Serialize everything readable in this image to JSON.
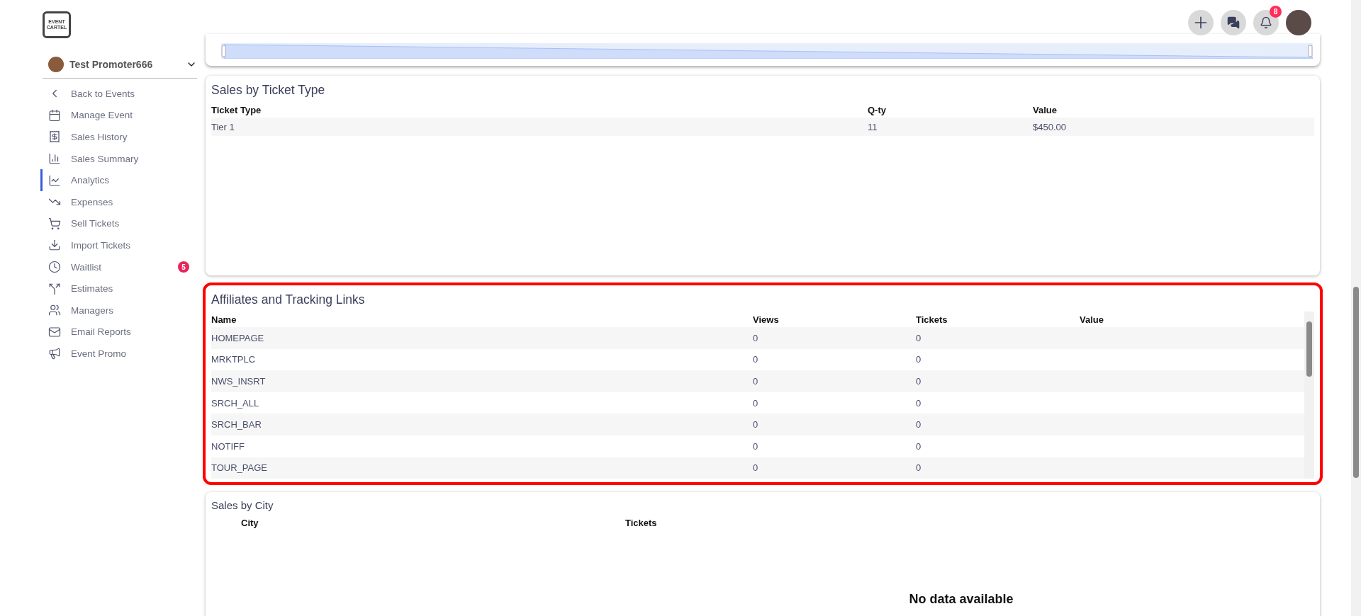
{
  "logo": {
    "line_1": "EVENT",
    "line_2": "CARTEL"
  },
  "header": {
    "notifications_badge": "8"
  },
  "sidebar": {
    "profile_name": "Test Promoter666",
    "items": [
      {
        "label": "Back to Events",
        "selected": false
      },
      {
        "label": "Manage Event",
        "selected": false
      },
      {
        "label": "Sales History",
        "selected": false
      },
      {
        "label": "Sales Summary",
        "selected": false
      },
      {
        "label": "Analytics",
        "selected": true
      },
      {
        "label": "Expenses",
        "selected": false
      },
      {
        "label": "Sell Tickets",
        "selected": false
      },
      {
        "label": "Import Tickets",
        "selected": false
      },
      {
        "label": "Waitlist",
        "selected": false,
        "badge": "5"
      },
      {
        "label": "Estimates",
        "selected": false
      },
      {
        "label": "Managers",
        "selected": false
      },
      {
        "label": "Email Reports",
        "selected": false
      },
      {
        "label": "Event Promo",
        "selected": false
      }
    ]
  },
  "ticket_types": {
    "title": "Sales by Ticket Type",
    "columns": [
      "Ticket Type",
      "Q-ty",
      "Value"
    ],
    "rows": [
      [
        "Tier 1",
        "11",
        "$450.00"
      ]
    ]
  },
  "affiliates": {
    "title": "Affiliates and Tracking Links",
    "highlighted": true,
    "columns": [
      "Name",
      "Views",
      "Tickets",
      "Value"
    ],
    "rows": [
      [
        "HOMEPAGE",
        "0",
        "0",
        ""
      ],
      [
        "MRKTPLC",
        "0",
        "0",
        ""
      ],
      [
        "NWS_INSRT",
        "0",
        "0",
        ""
      ],
      [
        "SRCH_ALL",
        "0",
        "0",
        ""
      ],
      [
        "SRCH_BAR",
        "0",
        "0",
        ""
      ],
      [
        "NOTIFF",
        "0",
        "0",
        ""
      ],
      [
        "TOUR_PAGE",
        "0",
        "0",
        ""
      ]
    ]
  },
  "cities": {
    "title": "Sales by City",
    "columns": [
      "City",
      "Tickets"
    ],
    "empty_message": "No data available"
  }
}
